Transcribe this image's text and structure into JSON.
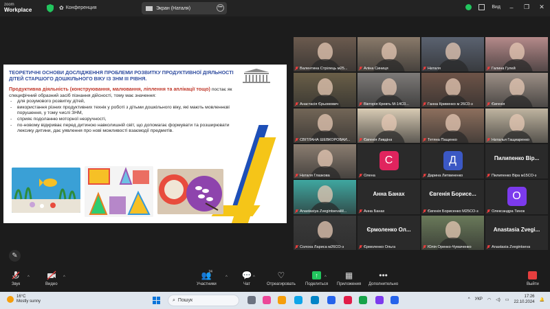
{
  "titlebar": {
    "brand_top": "zoom",
    "brand_bottom": "Workplace",
    "conference": "Конференция",
    "screen_share": "Экран (Наталя)",
    "view": "Вид"
  },
  "slide": {
    "title": "ТЕОРЕТИЧНІ ОСНОВИ ДОСЛІДЖЕННЯ ПРОБЛЕМИ РОЗВИТКУ ПРОДУКТИВНОЇ ДІЯЛЬНОСТІ ДІТЕЙ СТАРШОГО ДОШКІЛЬНОГО ВІКУ ІЗ ЗНМ ІІІ РІВНЯ.",
    "lead_red": "Продуктивна діяльність (конструювання, малювання, ліплення та аплікації тощо)",
    "lead_rest": " постає як",
    "line2": "специфічний образний засіб пізнання дійсності, тому має значення:",
    "bullets": [
      "для розумового розвитку дітей,",
      "використання різних продуктивних технік у роботі з дітьми дошкільного віку, які мають мовленнєві порушення, у тому числі ЗНМ,",
      "сприяє подоланню моторної незручності,",
      "по-новому відкриває перед дитиною навколишній світ, що допомагає формувати та розширювати лексику дитини, дає уявлення про нові можливості взаємодії предметів."
    ]
  },
  "participants": [
    {
      "name": "Валентина Стрілець м25...",
      "kind": "video",
      "bg": "#6b5a4e"
    },
    {
      "name": "Аліна Синиця",
      "kind": "video",
      "bg": "#8a7a6a"
    },
    {
      "name": "Наталя",
      "kind": "video",
      "bg": "#5a6270"
    },
    {
      "name": "Галина Гулей",
      "kind": "video",
      "bg": "#b58a8a"
    },
    {
      "name": "Анастасія Єрьомович",
      "kind": "video",
      "bg": "#6a5f48"
    },
    {
      "name": "Вікторія Кревть М-14С0...",
      "kind": "video",
      "bg": "#7d7a78"
    },
    {
      "name": "Ганна Кривенко м 26С0-з",
      "kind": "video",
      "bg": "#6e5448"
    },
    {
      "name": "Євгенія",
      "kind": "video",
      "bg": "#9c8f86"
    },
    {
      "name": "СВІТЛАНА ШЕВКОРОВАЙ...",
      "kind": "video",
      "bg": "#736657"
    },
    {
      "name": "Євгенія Ливдіна",
      "kind": "video",
      "bg": "#d8cbb4"
    },
    {
      "name": "Тетяна Пащенко",
      "kind": "video",
      "bg": "#8d6f5d"
    },
    {
      "name": "Наталья Гащиаренко",
      "kind": "video",
      "bg": "#bfb4a0",
      "active": true
    },
    {
      "name": "Наталя Глазкова",
      "kind": "video",
      "bg": "#8b7d70"
    },
    {
      "name": "Олена",
      "kind": "avatar",
      "letter": "С",
      "color": "#e0245e"
    },
    {
      "name": "Дарина Литвиненко",
      "kind": "avatar",
      "letter": "Д",
      "color": "#3b58c4"
    },
    {
      "name": "Пилипенко Віра м15СО-з",
      "kind": "bigname",
      "label": "Пилипенко Вір..."
    },
    {
      "name": "Anastasiya ZvegintsevaM...",
      "kind": "video",
      "bg": "#3fa7a0"
    },
    {
      "name": "Анна Банах",
      "kind": "bigname",
      "label": "Анна Банах"
    },
    {
      "name": "Євгенія Борисенко М25СО-з",
      "kind": "bigname",
      "label": "Євгенія Борисе..."
    },
    {
      "name": "Олександра Тинок",
      "kind": "avatar",
      "letter": "О",
      "color": "#7c3aed"
    },
    {
      "name": "Солоха Лариса м26СО-з",
      "kind": "video",
      "bg": "#3a3a3a"
    },
    {
      "name": "Єрмоленко Ольга",
      "kind": "bigname",
      "label": "Єрмоленко Ол..."
    },
    {
      "name": "Юлія Оренко-Чумаченко",
      "kind": "video",
      "bg": "#6a7a5a"
    },
    {
      "name": "Anastasia Zvegintseva",
      "kind": "bigname",
      "label": "Anastasia Zvegi..."
    }
  ],
  "toolbar": {
    "mute": "Звук",
    "video": "Видео",
    "participants": "Участники",
    "participants_count": "24",
    "chat": "Чат",
    "react": "Отреагировать",
    "share": "Поделиться",
    "apps": "Приложения",
    "more": "Дополнительно",
    "leave": "Выйти"
  },
  "taskbar": {
    "temp": "16°C",
    "weather": "Mostly sunny",
    "search": "Пошук",
    "lang": "УКР",
    "time": "17:26",
    "date": "22.10.2024"
  }
}
